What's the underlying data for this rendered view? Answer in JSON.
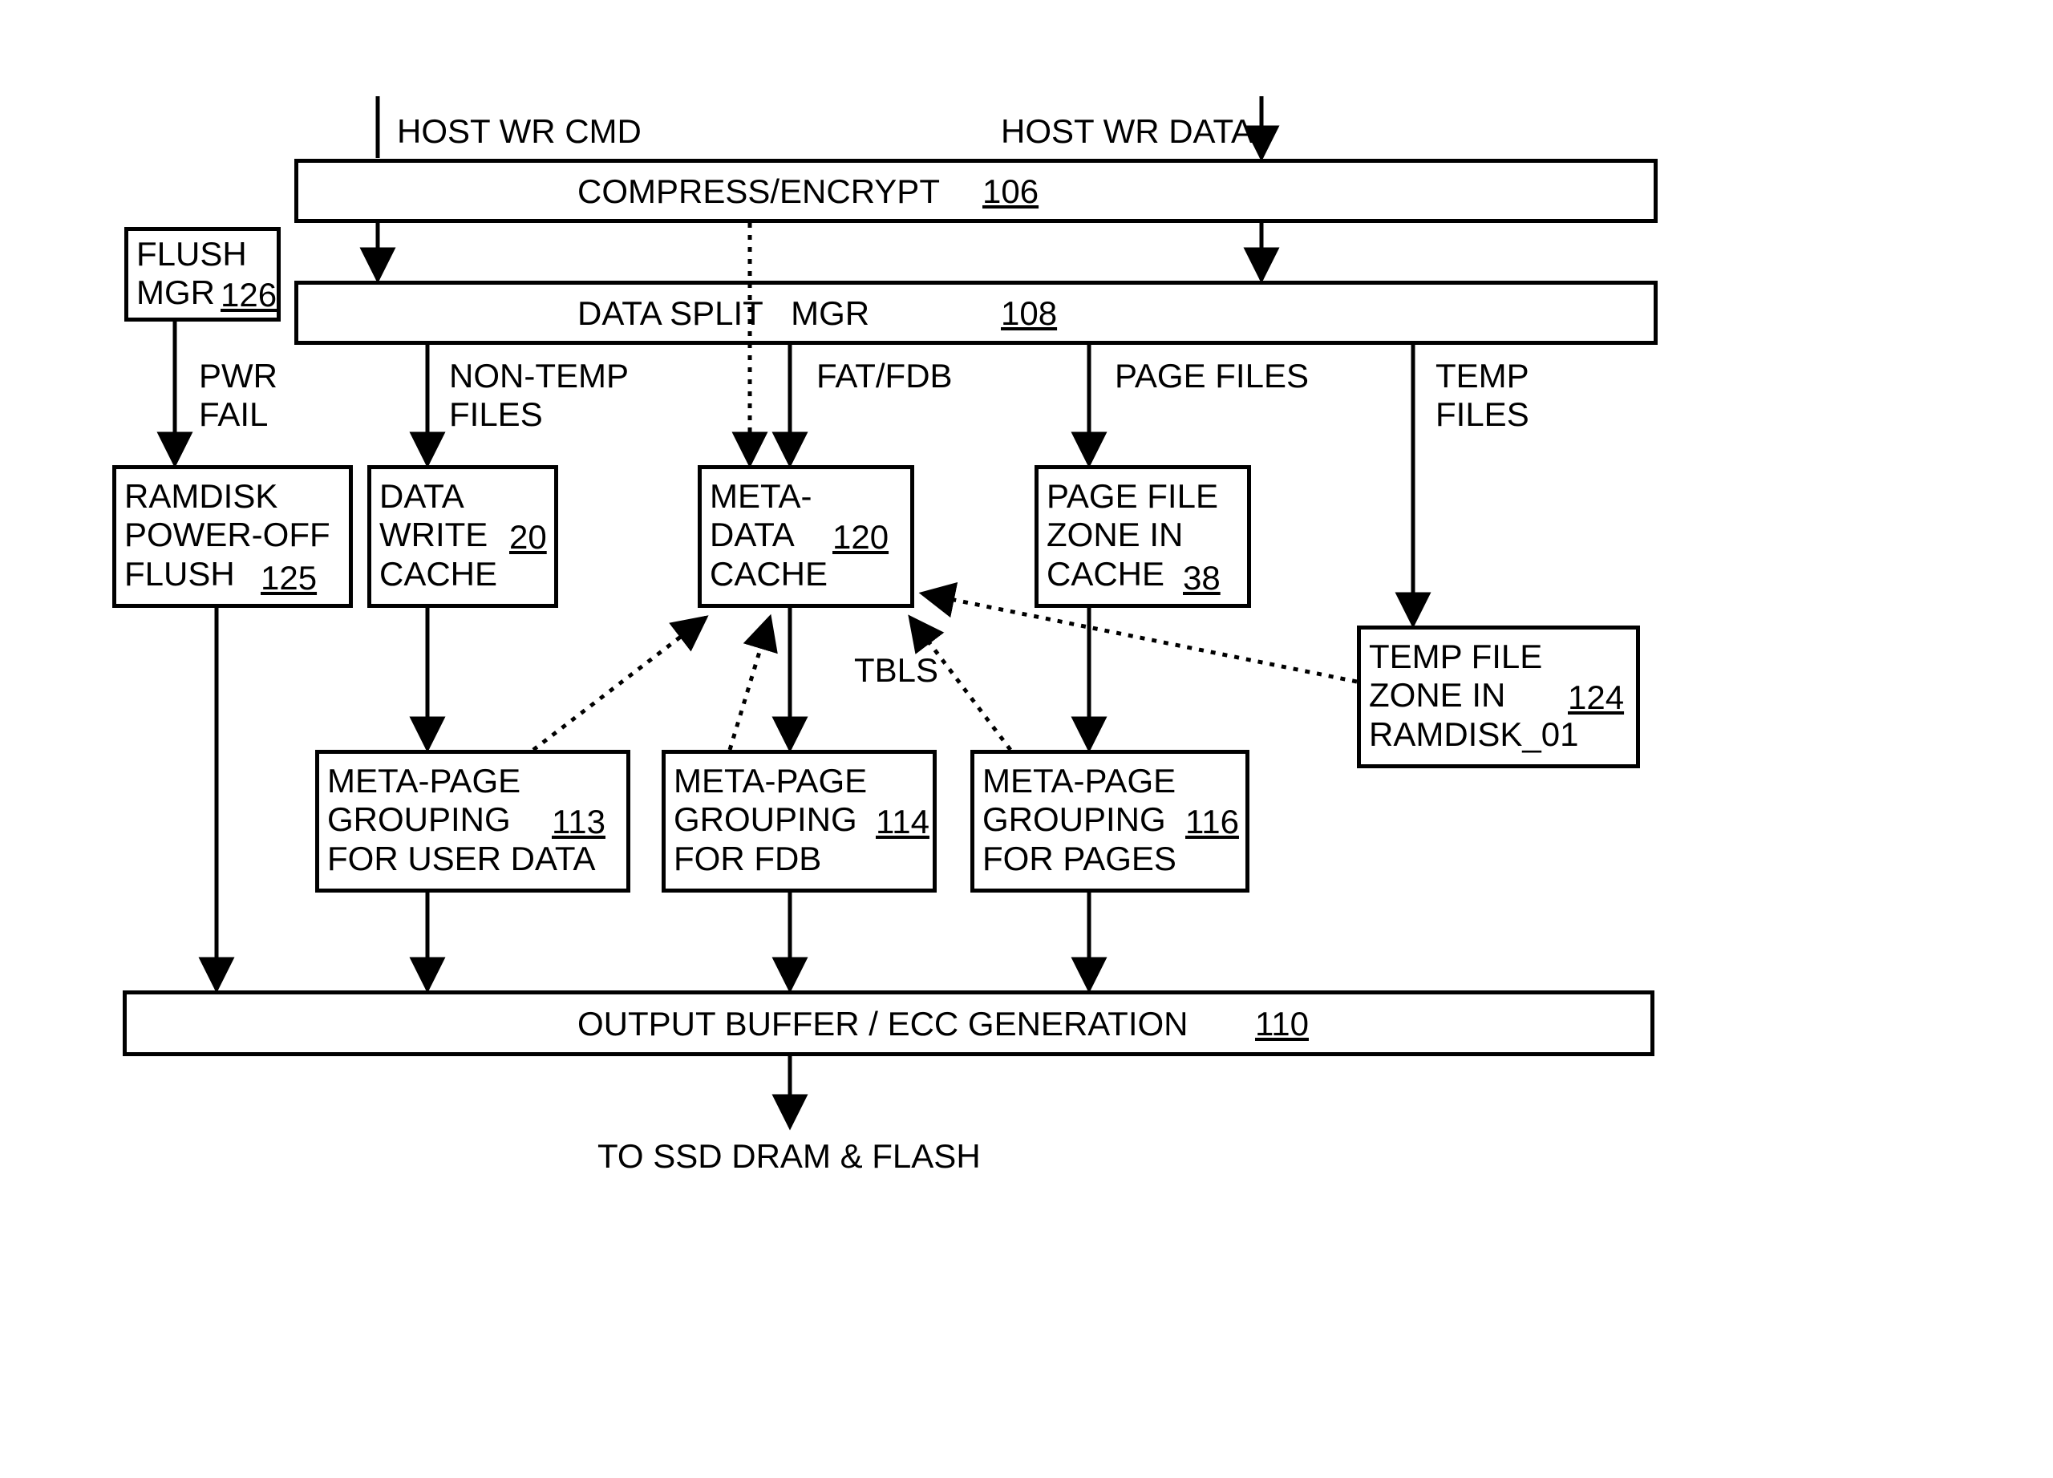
{
  "labels": {
    "host_wr_cmd": "HOST WR CMD",
    "host_wr_data": "HOST WR DATA",
    "compress_encrypt": "COMPRESS/ENCRYPT",
    "compress_encrypt_ref": "106",
    "data_split_mgr": "DATA SPLIT   MGR",
    "data_split_mgr_ref": "108",
    "flush_mgr": "FLUSH\nMGR",
    "flush_mgr_ref": "126",
    "pwr_fail": "PWR\nFAIL",
    "non_temp_files": "NON-TEMP\nFILES",
    "fat_fdb": "FAT/FDB",
    "page_files": "PAGE FILES",
    "temp_files": "TEMP\nFILES",
    "ramdisk_flush": "RAMDISK\nPOWER-OFF\nFLUSH",
    "ramdisk_flush_ref": "125",
    "data_write_cache": "DATA\nWRITE\nCACHE",
    "data_write_cache_ref": "20",
    "meta_data_cache": "META-\nDATA\nCACHE",
    "meta_data_cache_ref": "120",
    "page_file_zone": "PAGE FILE\nZONE IN\nCACHE",
    "page_file_zone_ref": "38",
    "temp_file_zone": "TEMP FILE\nZONE IN\nRAMDISK_01",
    "temp_file_zone_ref": "124",
    "tbls": "TBLS",
    "mpg_user": "META-PAGE\nGROUPING\nFOR USER DATA",
    "mpg_user_ref": "113",
    "mpg_fdb": "META-PAGE\nGROUPING\nFOR FDB",
    "mpg_fdb_ref": "114",
    "mpg_pages": "META-PAGE\nGROUPING\nFOR PAGES",
    "mpg_pages_ref": "116",
    "output_buffer": "OUTPUT BUFFER / ECC GENERATION",
    "output_buffer_ref": "110",
    "to_ssd": "TO SSD DRAM & FLASH"
  }
}
